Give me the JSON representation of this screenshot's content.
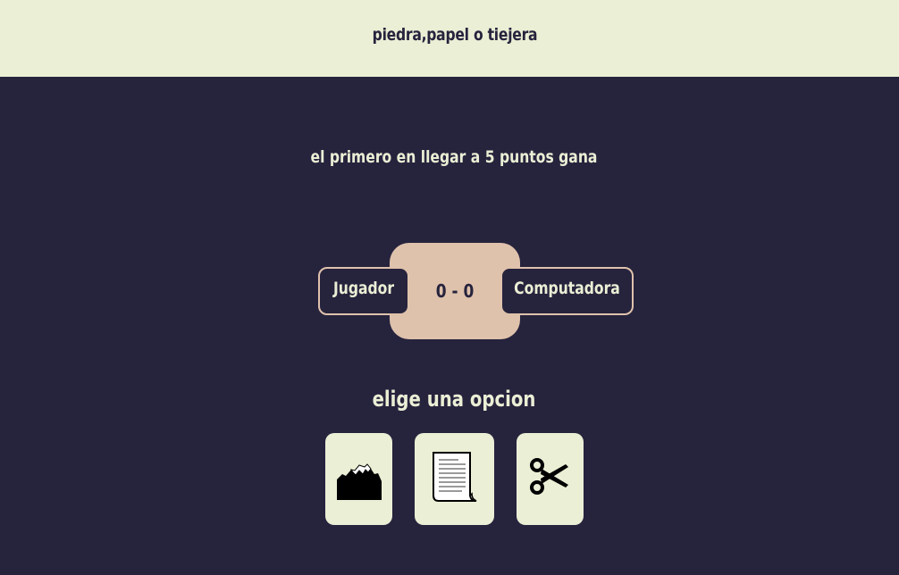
{
  "header": {
    "title": "piedra,papel o tiejera"
  },
  "rules": {
    "text": "el primero en llegar a 5 puntos gana"
  },
  "scoreboard": {
    "player_label": "Jugador",
    "computer_label": "Computadora",
    "score": "0 - 0",
    "player_score": 0,
    "computer_score": 0,
    "target_points": 5
  },
  "choices": {
    "prompt": "elige una opcion",
    "options": [
      {
        "id": "piedra",
        "icon": "mountain-rock-icon"
      },
      {
        "id": "papel",
        "icon": "paper-scroll-icon"
      },
      {
        "id": "tijera",
        "icon": "scissors-icon"
      }
    ]
  },
  "colors": {
    "background": "#26233d",
    "header_bg": "#eaefd5",
    "accent": "#dfc2ac",
    "text_light": "#eaefd5",
    "text_dark": "#26233d"
  }
}
